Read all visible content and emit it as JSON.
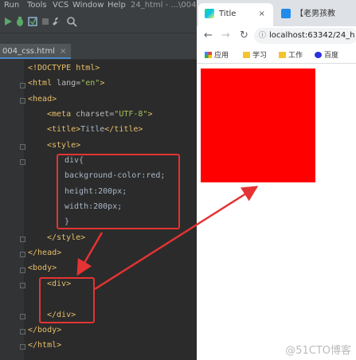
{
  "ide": {
    "menu": [
      "Run",
      "Tools",
      "VCS",
      "Window",
      "Help",
      "24_html - ...\\004"
    ],
    "tab_label": "004_css.html",
    "code": {
      "l1": "<!DOCTYPE html>",
      "l2_open": "<html ",
      "l2_attr": "lang=",
      "l2_val": "\"en\"",
      "l2_close": ">",
      "l3": "<head>",
      "l4_open": "<meta ",
      "l4_attr": "charset=",
      "l4_val": "\"UTF-8\"",
      "l4_close": ">",
      "l5_open": "<title>",
      "l5_text": "Title",
      "l5_close": "</title>",
      "l6": "<style>",
      "l7": "div{",
      "l8": "background-color:red;",
      "l9": "height:200px;",
      "l10": "width:200px;",
      "l11": "}",
      "l12": "</style>",
      "l13": "</head>",
      "l14": "<body>",
      "l15": "<div>",
      "l16": "",
      "l17": "</div>",
      "l18": "</body>",
      "l19": "</html>"
    }
  },
  "browser": {
    "active_tab": "Title",
    "other_tab": "【老男孩教",
    "address": "localhost:63342/24_h",
    "bookmarks": [
      "应用",
      "学习",
      "工作",
      "百度"
    ],
    "watermark": "@51CTO博客"
  },
  "colors": {
    "highlight": "#e53333",
    "div_background": "#ff0000"
  }
}
